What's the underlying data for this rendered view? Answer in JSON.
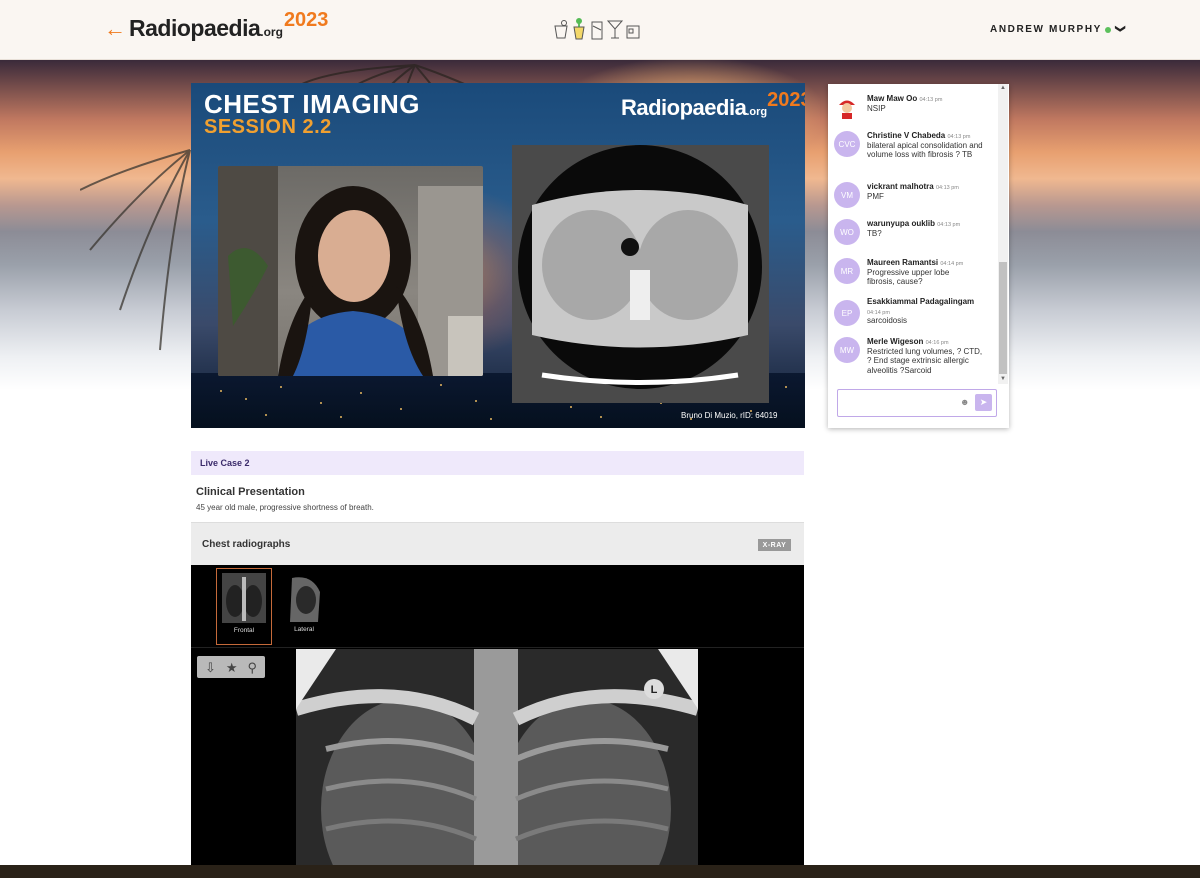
{
  "header": {
    "logo_arrow": "←",
    "logo_name": "Radiopaedia",
    "logo_org": ".org",
    "logo_year": "2023",
    "user_name": "ANDREW MURPHY",
    "user_chevron": "❯",
    "drink_icons": [
      "cocktail-icon",
      "tropical-drink-icon",
      "beer-icon",
      "martini-icon",
      "tumbler-icon"
    ]
  },
  "video": {
    "title_line1": "CHEST IMAGING",
    "title_line2": "SESSION 2.2",
    "logo_name": "Radiopaedia",
    "logo_org": ".org",
    "logo_year": "2023",
    "credit": "Bruno Di Muzio, rID: 64019"
  },
  "chat": {
    "messages": [
      {
        "name": "Maw Maw Oo",
        "time": "04:13 pm",
        "text": "NSIP",
        "initials": ""
      },
      {
        "name": "Christine V Chabeda",
        "time": "04:13 pm",
        "text": "bilateral apical consolidation and volume loss with fibrosis ? TB",
        "initials": "CVC"
      },
      {
        "name": "vickrant malhotra",
        "time": "04:13 pm",
        "text": "PMF",
        "initials": "VM"
      },
      {
        "name": "warunyupa ouklib",
        "time": "04:13 pm",
        "text": "TB?",
        "initials": "WO"
      },
      {
        "name": "Maureen Ramantsi",
        "time": "04:14 pm",
        "text": "Progressive upper lobe fibrosis, cause?",
        "initials": "MR"
      },
      {
        "name": "Esakkiammal Padagalingam",
        "time": "04:14 pm",
        "text": "sarcoidosis",
        "initials": "EP"
      },
      {
        "name": "Merle Wigeson",
        "time": "04:16 pm",
        "text": "Restricted lung volumes, ? CTD, ? End stage extrinsic allergic alveolitis ?Sarcoid",
        "initials": "MW"
      }
    ],
    "input_placeholder": "",
    "emoji_icon": "☻",
    "send_icon": "➤"
  },
  "case": {
    "live_case_label": "Live Case 2",
    "clinical_title": "Clinical Presentation",
    "clinical_text": "45 year old male, progressive shortness of breath.",
    "study_title": "Chest radiographs",
    "study_badge": "X-RAY",
    "thumbnails": [
      {
        "label": "Frontal"
      },
      {
        "label": "Lateral"
      }
    ],
    "tools": {
      "download": "⇩",
      "star": "★",
      "pin": "⚲"
    },
    "marker": "L"
  },
  "colors": {
    "accent_orange": "#f07a1e",
    "chat_avatar": "#c9b5ee",
    "live_case_bg": "#efe9fb",
    "online_dot": "#5cc05c"
  }
}
